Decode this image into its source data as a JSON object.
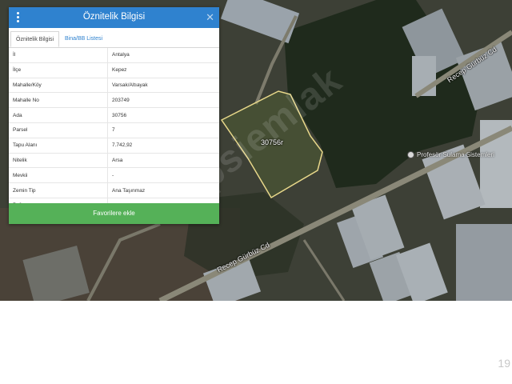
{
  "map": {
    "parcel_label": "30756r",
    "road_labels": [
      "Recep Gürbüz Cd",
      "Recep Gürbüz Cd"
    ],
    "poi_label": "Profesör Sulama Sistemleri",
    "watermark": "hepsiemlak"
  },
  "panel": {
    "title": "Öznitelik Bilgisi",
    "close_glyph": "✕",
    "tabs": [
      {
        "label": "Öznitelik Bilgisi",
        "active": true
      },
      {
        "label": "Bina/BB Listesi",
        "active": false
      }
    ],
    "rows": [
      {
        "key": "İl",
        "value": "Antalya"
      },
      {
        "key": "İlçe",
        "value": "Kepez"
      },
      {
        "key": "Mahalle/Köy",
        "value": "Varsak/Altıayak"
      },
      {
        "key": "Mahalle No",
        "value": "203749"
      },
      {
        "key": "Ada",
        "value": "30756"
      },
      {
        "key": "Parsel",
        "value": "7"
      },
      {
        "key": "Tapu Alanı",
        "value": "7.742,92"
      },
      {
        "key": "Nitelik",
        "value": "Arsa"
      },
      {
        "key": "Mevkii",
        "value": "-"
      },
      {
        "key": "Zemin Tip",
        "value": "Ana Taşınmaz"
      },
      {
        "key": "Pafta",
        "value": "-"
      }
    ],
    "button_label": "Favorilere ekle"
  },
  "page_number": "19",
  "colors": {
    "header": "#2f82cf",
    "button": "#55b158",
    "parcel_outline": "#e8d88a"
  }
}
